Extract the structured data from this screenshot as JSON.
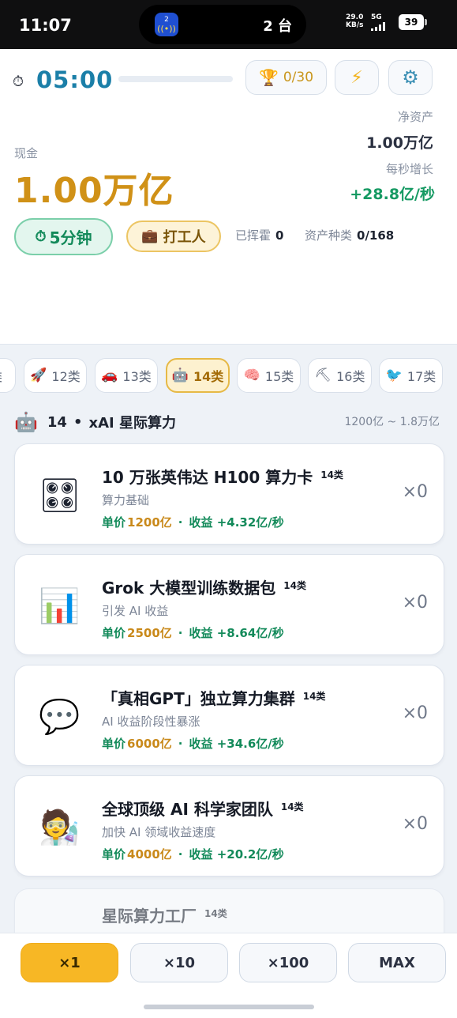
{
  "status_bar": {
    "time": "11:07",
    "island_app_badge": "2",
    "island_text": "2 台",
    "net_speed_value": "29.0",
    "net_speed_unit": "KB/s",
    "network": "5G",
    "battery": "39"
  },
  "header": {
    "timer": "05:00",
    "timer_progress": 0,
    "trophy_count": "0/30",
    "net_assets_label": "净资产",
    "net_assets_value": "1.00万亿",
    "growth_label": "每秒增长",
    "growth_value": "+28.8亿/秒",
    "cash_label": "现金",
    "cash_value": "1.00万亿",
    "time_chip": "5分钟",
    "work_chip": "打工人",
    "spent_label": "已挥霍",
    "spent_value": "0",
    "kinds_label": "资产种类",
    "kinds_value": "0/168"
  },
  "tabs": [
    {
      "icon": "",
      "label": "类"
    },
    {
      "icon": "🚀",
      "label": "12类"
    },
    {
      "icon": "🚗",
      "label": "13类"
    },
    {
      "icon": "🤖",
      "label": "14类"
    },
    {
      "icon": "🧠",
      "label": "15类"
    },
    {
      "icon": "⛏",
      "label": "16类"
    },
    {
      "icon": "🐦",
      "label": "17类"
    }
  ],
  "section": {
    "icon": "🤖",
    "number": "14",
    "dot": "•",
    "title": "xAI 星际算力",
    "range": "1200亿 ~ 1.8万亿"
  },
  "items": [
    {
      "icon": "🎛",
      "name": "10 万张英伟达 H100 算力卡",
      "tag": "14类",
      "desc": "算力基础",
      "price_label": "单价",
      "price": "1200亿",
      "sep": "·",
      "yield": "收益 +4.32亿/秒",
      "count": "×0"
    },
    {
      "icon": "📊",
      "name": "Grok 大模型训练数据包",
      "tag": "14类",
      "desc": "引发 AI 收益",
      "price_label": "单价",
      "price": "2500亿",
      "sep": "·",
      "yield": "收益 +8.64亿/秒",
      "count": "×0"
    },
    {
      "icon": "💬",
      "name": "「真相GPT」独立算力集群",
      "tag": "14类",
      "desc": "AI 收益阶段性暴涨",
      "price_label": "单价",
      "price": "6000亿",
      "sep": "·",
      "yield": "收益 +34.6亿/秒",
      "count": "×0"
    },
    {
      "icon": "🧑‍🔬",
      "name": "全球顶级 AI 科学家团队",
      "tag": "14类",
      "desc": "加快 AI 领域收益速度",
      "price_label": "单价",
      "price": "4000亿",
      "sep": "·",
      "yield": "收益 +20.2亿/秒",
      "count": "×0"
    },
    {
      "icon": "",
      "name": "星际算力工厂",
      "tag": "14类",
      "desc": "",
      "price_label": "",
      "price": "",
      "sep": "",
      "yield": "",
      "count": ""
    }
  ],
  "multipliers": [
    "×1",
    "×10",
    "×100",
    "MAX"
  ],
  "colors": {
    "accent_gold": "#d09117",
    "timer_blue": "#1b7fa8",
    "growth_green": "#169a63",
    "active_multiplier": "#f7b725"
  },
  "icons": {
    "timer": "stopwatch-icon",
    "trophy": "trophy-icon",
    "boost": "lightning-icon",
    "settings": "gear-icon",
    "work": "briefcase-icon"
  }
}
